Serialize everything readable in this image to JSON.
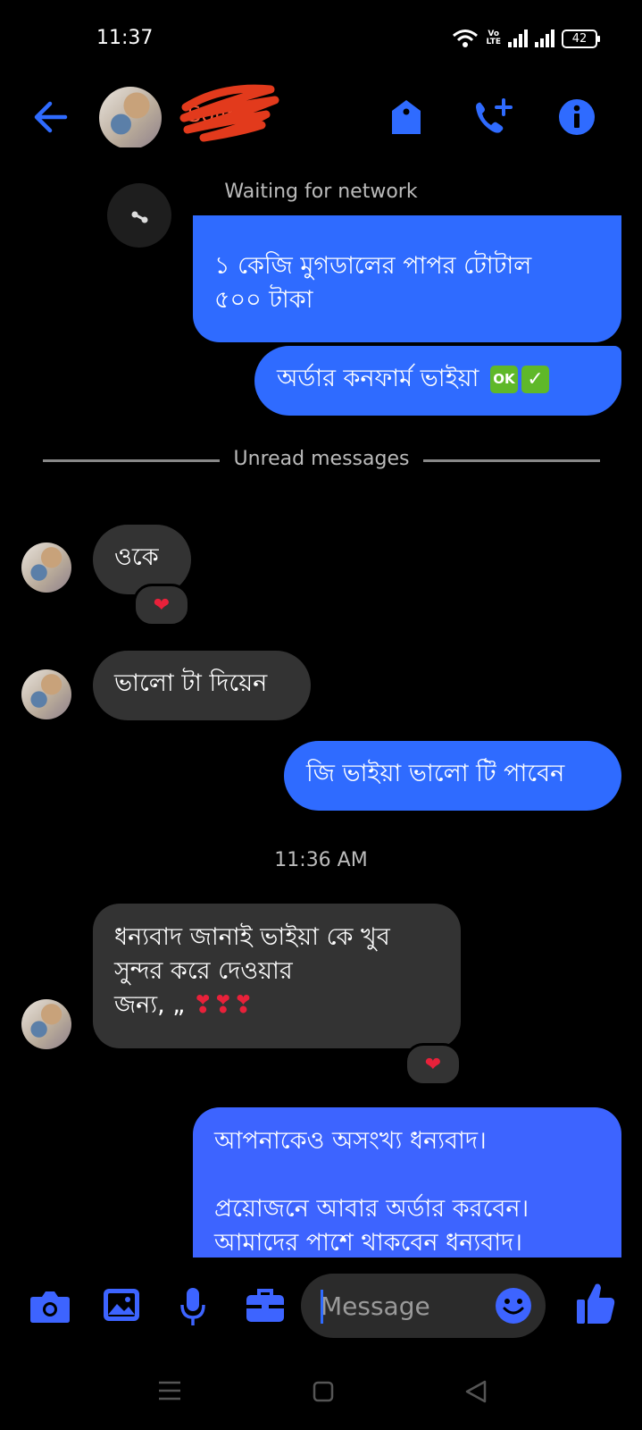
{
  "status_bar": {
    "time": "11:37",
    "volte_top": "Vo",
    "volte_bottom": "LTE",
    "battery": "42"
  },
  "header": {
    "contact_name": "Sojib",
    "icons": [
      "back-arrow-icon",
      "tag-icon",
      "add-call-icon",
      "info-icon"
    ]
  },
  "system": {
    "network": "Waiting for network",
    "unread": "Unread messages",
    "timestamp": "11:36 AM"
  },
  "messages": [
    {
      "dir": "out",
      "text_1": "১ কেজি মুগডালের পাপর টোটাল",
      "text_2": "৫০০ টাকা"
    },
    {
      "dir": "out",
      "text": "অর্ডার কনফার্ম ভাইয়া",
      "emoji_ok": "OK",
      "emoji_check": "✓"
    },
    {
      "dir": "in",
      "text": "ওকে",
      "reaction": "❤"
    },
    {
      "dir": "in",
      "text": "ভালো টা দিয়েন"
    },
    {
      "dir": "out",
      "text": "জি ভাইয়া ভালো টি পাবেন"
    },
    {
      "dir": "in",
      "text_1": "ধন্যবাদ জানাই ভাইয়া কে খুব",
      "text_2": "সুন্দর করে দেওয়ার",
      "text_3": "জন্য, „",
      "hearts": "❣❣❣",
      "reaction": "❤"
    },
    {
      "dir": "out",
      "text_1": "আপনাকেও অসংখ্য ধন্যবাদ।",
      "text_2": "প্রয়োজনে আবার অর্ডার করবেন।",
      "text_3": "আমাদের পাশে থাকবেন ধন্যবাদ।"
    }
  ],
  "composer": {
    "placeholder": "Message"
  },
  "colors": {
    "accent": "#2f6bff",
    "incoming": "#333333",
    "heart": "#e8213a"
  }
}
